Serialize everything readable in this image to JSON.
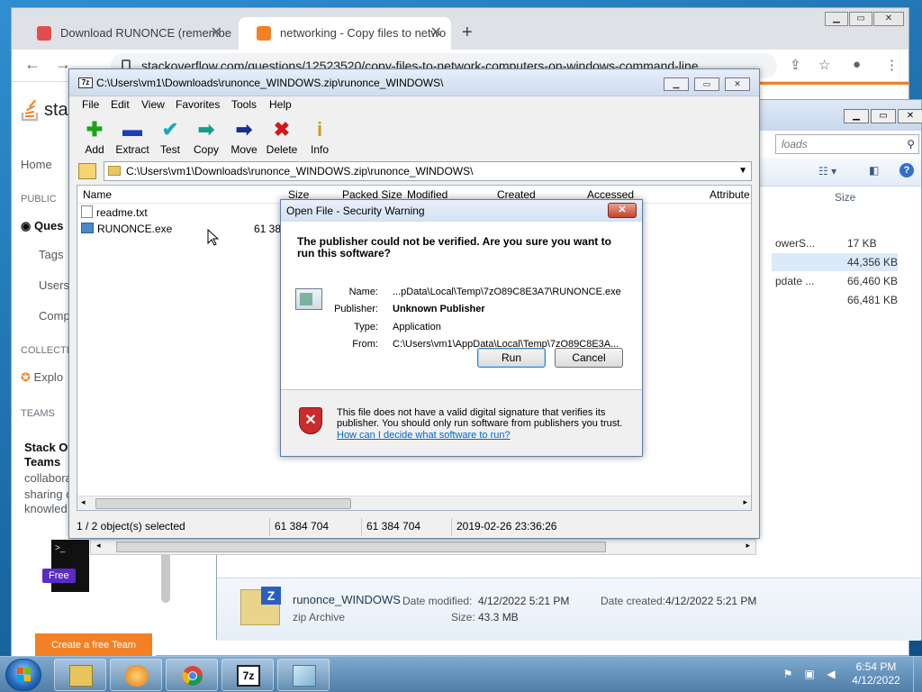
{
  "chrome": {
    "tabs": [
      {
        "title": "Download RUNONCE (remembe",
        "active": false
      },
      {
        "title": "networking - Copy files to netwo",
        "active": true
      }
    ],
    "url": "stackoverflow.com/questions/12523520/copy-files-to-network-computers-on-windows-command-line"
  },
  "so": {
    "logo_text": "stac",
    "nav": {
      "home": "Home",
      "public": "PUBLIC",
      "questions": "Ques",
      "tags": "Tags",
      "users": "Users",
      "companies": "Comp",
      "collectives": "COLLECTIV",
      "explore": "Explo",
      "teams": "TEAMS"
    },
    "teams_title_1": "Stack Ov",
    "teams_title_2": "Teams",
    "teams_text_1": "collabora",
    "teams_text_2": "sharing o",
    "teams_text_3": "knowled",
    "free_badge": "Free",
    "cta": "Create a free Team"
  },
  "explorer": {
    "search_placeholder": "loads",
    "col_size": "Size",
    "rows": [
      {
        "name": "owerS...",
        "size": "17 KB"
      },
      {
        "name": "",
        "size": "44,356 KB"
      },
      {
        "name": "pdate ...",
        "size": "66,460 KB"
      },
      {
        "name": "",
        "size": "66,481 KB"
      }
    ],
    "details": {
      "name": "runonce_WINDOWS",
      "type": "zip Archive",
      "modified_label": "Date modified:",
      "modified": "4/12/2022 5:21 PM",
      "created_label": "Date created:",
      "created": "4/12/2022 5:21 PM",
      "size_label": "Size:",
      "size": "43.3 MB"
    }
  },
  "sevenzip": {
    "title_icon": "7z",
    "title": "C:\\Users\\vm1\\Downloads\\runonce_WINDOWS.zip\\runonce_WINDOWS\\",
    "menu": [
      "File",
      "Edit",
      "View",
      "Favorites",
      "Tools",
      "Help"
    ],
    "toolbar": [
      {
        "label": "Add",
        "icon": "add-icon",
        "glyph": "✚",
        "color": "#1aa31a"
      },
      {
        "label": "Extract",
        "icon": "extract-icon",
        "glyph": "▬",
        "color": "#1a3fb8"
      },
      {
        "label": "Test",
        "icon": "test-icon",
        "glyph": "✔",
        "color": "#1aa8b8"
      },
      {
        "label": "Copy",
        "icon": "copy-icon",
        "glyph": "➡",
        "color": "#1a9a8a"
      },
      {
        "label": "Move",
        "icon": "move-icon",
        "glyph": "➡",
        "color": "#1a2f8a"
      },
      {
        "label": "Delete",
        "icon": "delete-icon",
        "glyph": "✖",
        "color": "#d01a1a"
      },
      {
        "label": "Info",
        "icon": "info-icon",
        "glyph": "i",
        "color": "#c8a010"
      }
    ],
    "path": "C:\\Users\\vm1\\Downloads\\runonce_WINDOWS.zip\\runonce_WINDOWS\\",
    "columns": [
      "Name",
      "Size",
      "Packed Size",
      "Modified",
      "Created",
      "Accessed",
      "Attribute"
    ],
    "files": [
      {
        "name": "readme.txt",
        "size": ""
      },
      {
        "name": "RUNONCE.exe",
        "size": "61 38"
      }
    ],
    "status": {
      "selected": "1 / 2 object(s) selected",
      "size": "61 384 704",
      "packed": "61 384 704",
      "date": "2019-02-26 23:36:26"
    }
  },
  "dialog": {
    "title": "Open File - Security Warning",
    "close": "✕",
    "question": "The publisher could not be verified.  Are you sure you want to run this software?",
    "fields": [
      {
        "label": "Name:",
        "value": "...pData\\Local\\Temp\\7zO89C8E3A7\\RUNONCE.exe",
        "bold": false
      },
      {
        "label": "Publisher:",
        "value": "Unknown Publisher",
        "bold": true
      },
      {
        "label": "Type:",
        "value": "Application",
        "bold": false
      },
      {
        "label": "From:",
        "value": "C:\\Users\\vm1\\AppData\\Local\\Temp\\7zO89C8E3A...",
        "bold": false
      }
    ],
    "run": "Run",
    "cancel": "Cancel",
    "warning": "This file does not have a valid digital signature that verifies its publisher.  You should only run software from publishers you trust.",
    "link": "How can I decide what software to run?"
  },
  "taskbar": {
    "time": "6:54 PM",
    "date": "4/12/2022"
  }
}
